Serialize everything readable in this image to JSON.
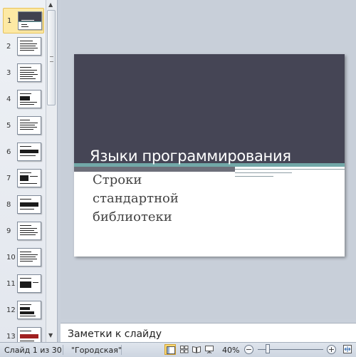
{
  "thumbnails": [
    {
      "number": "1",
      "selected": true
    },
    {
      "number": "2"
    },
    {
      "number": "3"
    },
    {
      "number": "4"
    },
    {
      "number": "5"
    },
    {
      "number": "6"
    },
    {
      "number": "7"
    },
    {
      "number": "8"
    },
    {
      "number": "9"
    },
    {
      "number": "10"
    },
    {
      "number": "11"
    },
    {
      "number": "12"
    },
    {
      "number": "13"
    }
  ],
  "slide": {
    "title": "Языки программирования",
    "subtitle_lines": [
      "Строки",
      "стандартной",
      "библиотеки"
    ],
    "colors": {
      "header": "#454555",
      "accent": "#72a8a8"
    }
  },
  "notes": {
    "placeholder": "Заметки к слайду"
  },
  "status": {
    "slide_counter": "Слайд 1 из 30",
    "theme": "\"Городская\"",
    "zoom": "40%",
    "zoom_level": 0.4
  },
  "icons": {
    "view_normal": "normal-view-icon",
    "view_sorter": "slide-sorter-icon",
    "view_reading": "reading-view-icon",
    "view_slideshow": "slideshow-icon",
    "fit": "fit-to-window-icon"
  }
}
